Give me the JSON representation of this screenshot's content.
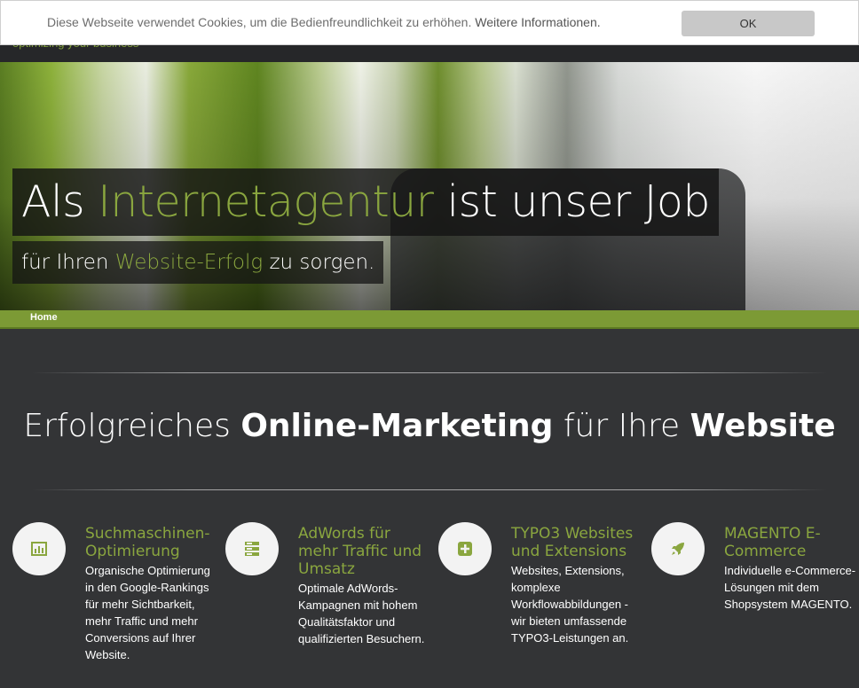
{
  "header": {
    "tagline": "optimizing your business"
  },
  "cookie_banner": {
    "text": "Diese Webseite verwendet Cookies, um die Bedienfreundlichkeit zu erhöhen.",
    "link": "Weitere Informationen.",
    "ok_label": "OK"
  },
  "hero": {
    "title_part1": "Als ",
    "title_accent": "Internetagentur",
    "title_part2": " ist unser Job",
    "sub_part1": "für Ihren ",
    "sub_accent": "Website-Erfolg",
    "sub_part2": " zu sorgen."
  },
  "breadcrumb": {
    "home": "Home"
  },
  "section": {
    "title_part1": "Erfolgreiches ",
    "title_bold1": "Online-Marketing",
    "title_part2": " für Ihre ",
    "title_bold2": "Website"
  },
  "features": [
    {
      "icon": "chart-icon",
      "title": "Suchmaschinen-Optimierung",
      "text": "Organische Optimierung in den Google-Rankings für mehr Sichtbarkeit, mehr Traffic und mehr Conversions auf Ihrer Website."
    },
    {
      "icon": "server-icon",
      "title": "AdWords für mehr Traffic und Umsatz",
      "text": "Optimale AdWords-Kampagnen mit hohem Qualitätsfaktor und qualifizierten Besuchern."
    },
    {
      "icon": "plus-square-icon",
      "title": "TYPO3 Websites und Extensions",
      "text": "Websites, Extensions, komplexe Workflowabbildungen - wir bieten umfassende TYPO3-Leistungen an."
    },
    {
      "icon": "rocket-icon",
      "title": "MAGENTO E-Commerce",
      "text": "Individuelle e-Commerce-Lösungen mit dem Shopsystem MAGENTO."
    }
  ],
  "colors": {
    "accent": "#8aa63f",
    "background": "#333436",
    "breadcrumb_bar": "#7c9a35"
  }
}
